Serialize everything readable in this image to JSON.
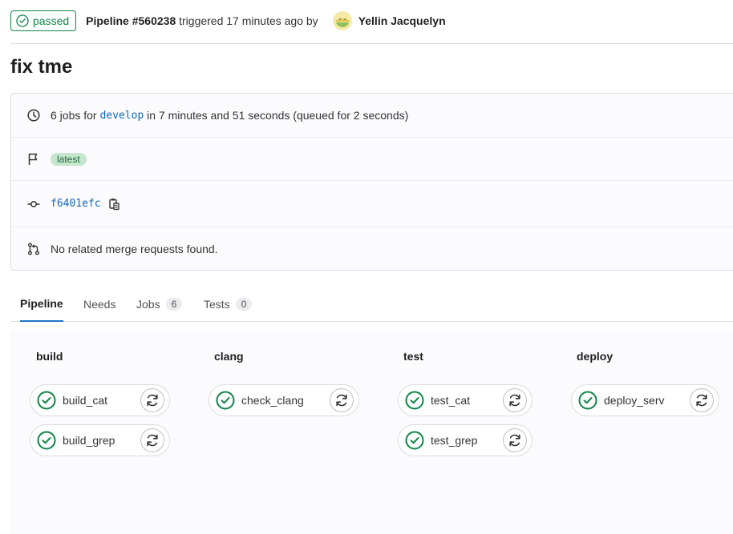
{
  "header": {
    "status_label": "passed",
    "pipeline_id": "Pipeline #560238",
    "triggered_text": "triggered 17 minutes ago by",
    "author": "Yellin Jacquelyn"
  },
  "title": "fix tme",
  "info": {
    "jobs_count_text": "6 jobs for",
    "branch": "develop",
    "duration_text": "in 7 minutes and 51 seconds (queued for 2 seconds)",
    "badge": "latest",
    "commit_sha": "f6401efc",
    "merge_text": "No related merge requests found."
  },
  "tabs": {
    "pipeline": "Pipeline",
    "needs": "Needs",
    "jobs": "Jobs",
    "jobs_count": "6",
    "tests": "Tests",
    "tests_count": "0"
  },
  "stages": {
    "build": {
      "title": "build",
      "jobs": [
        "build_cat",
        "build_grep"
      ]
    },
    "clang": {
      "title": "clang",
      "jobs": [
        "check_clang"
      ]
    },
    "test": {
      "title": "test",
      "jobs": [
        "test_cat",
        "test_grep"
      ]
    },
    "deploy": {
      "title": "deploy",
      "jobs": [
        "deploy_serv"
      ]
    }
  },
  "colors": {
    "success": "#108548",
    "link": "#1068bf",
    "tab_active": "#1f75cb"
  },
  "icons": {
    "status": "check-circle-icon",
    "retry": "retry-icon",
    "clock": "clock-icon",
    "flag": "flag-icon",
    "commit": "commit-icon",
    "merge_request": "merge-request-icon",
    "copy": "copy-to-clipboard-icon"
  }
}
